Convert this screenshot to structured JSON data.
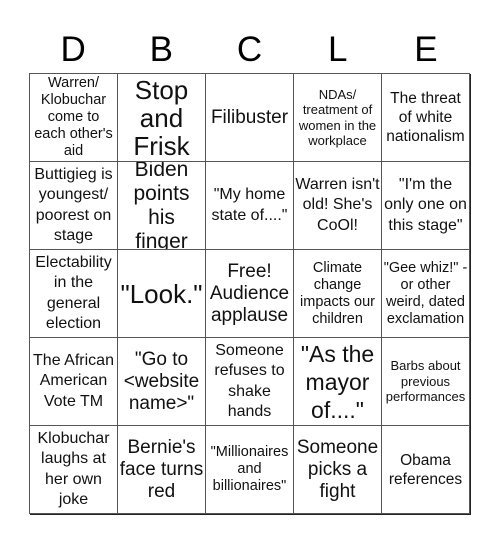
{
  "header": {
    "letters": [
      "D",
      "B",
      "C",
      "L",
      "E"
    ]
  },
  "board": {
    "rows": [
      [
        "Warren/ Klobuchar come to each other's aid",
        "Stop and Frisk",
        "Filibuster",
        "NDAs/ treatment of women in the workplace",
        "The threat of white nationalism"
      ],
      [
        "Buttigieg is youngest/ poorest on stage",
        "Biden points his finger",
        "\"My home state of....\"",
        "Warren isn't old! She's CoOl!",
        "\"I'm the only one on this stage\""
      ],
      [
        "Electability in the general election",
        "\"Look.\"",
        "Free! Audience applause",
        "Climate change impacts our children",
        "\"Gee whiz!\" - or other weird, dated exclamation"
      ],
      [
        "The African American Vote TM",
        "\"Go to <website name>\"",
        "Someone refuses to shake hands",
        "\"As the mayor of....\"",
        "Barbs about previous performances"
      ],
      [
        "Klobuchar laughs at her own joke",
        "Bernie's face turns red",
        "\"Millionaires and billionaires\"",
        "Someone picks a fight",
        "Obama references"
      ]
    ]
  }
}
